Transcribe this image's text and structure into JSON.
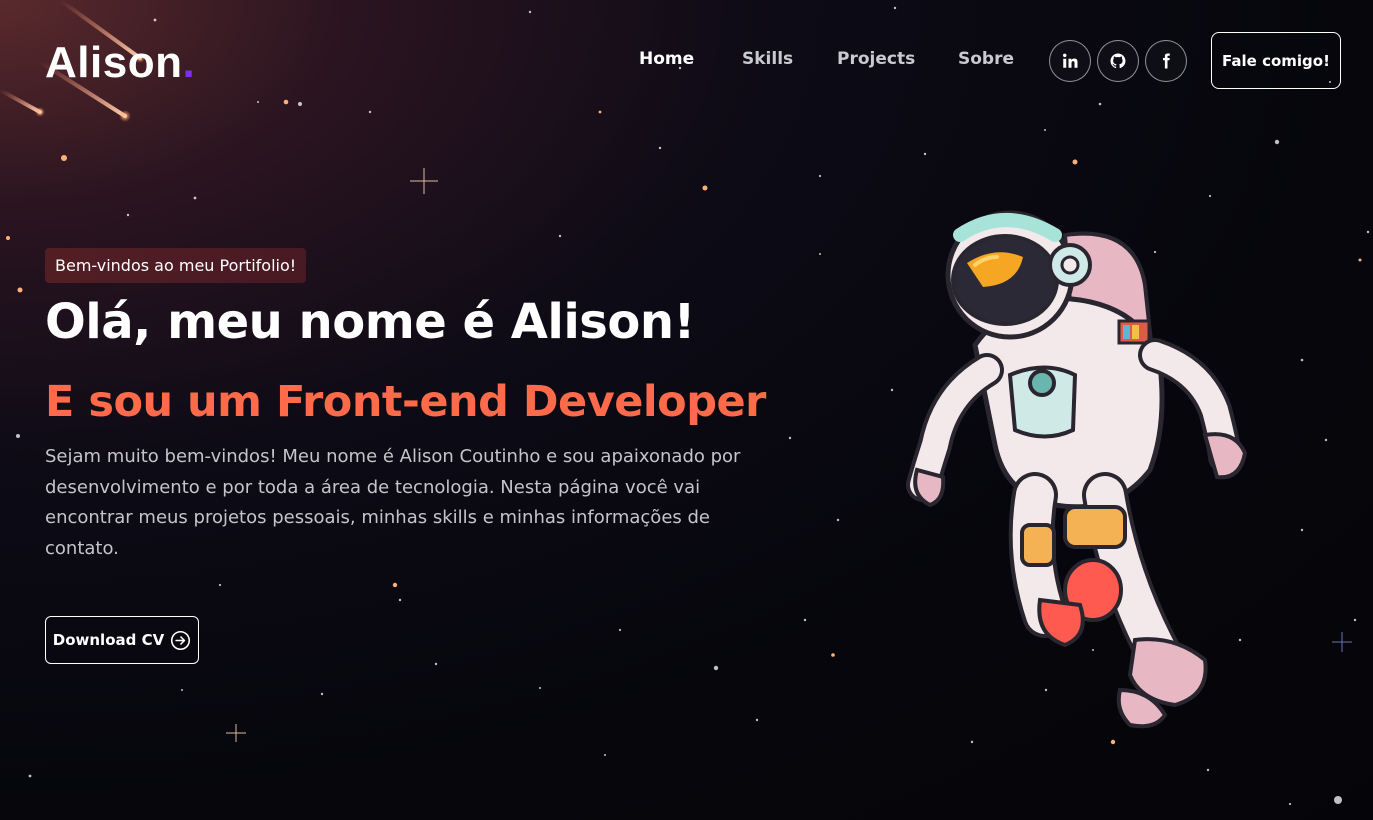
{
  "header": {
    "logo_text": "Alison",
    "logo_dot": ".",
    "nav": [
      {
        "label": "Home",
        "active": true
      },
      {
        "label": "Skills",
        "active": false
      },
      {
        "label": "Projects",
        "active": false
      },
      {
        "label": "Sobre",
        "active": false
      }
    ],
    "social": [
      {
        "icon": "linkedin-icon",
        "label": "in"
      },
      {
        "icon": "github-icon"
      },
      {
        "icon": "facebook-icon",
        "label": "f"
      }
    ],
    "cta_label": "Fale comigo!"
  },
  "hero": {
    "badge": "Bem-vindos ao meu Portifolio!",
    "title": "Olá, meu nome é Alison!",
    "subtitle": "E sou um Front-end Developer",
    "description": "Sejam muito bem-vindos! Meu nome é Alison Coutinho e sou apaixonado por desenvolvimento e por toda a área de tecnologia. Nesta página você vai encontrar meus projetos pessoais, minhas skills e minhas informações de contato.",
    "download_label": "Download CV",
    "download_icon": "arrow-right-circle-icon"
  },
  "illustration": {
    "name": "astronaut-illustration"
  },
  "colors": {
    "accent": "#ff6b4a",
    "logo_dot": "#7b2ff7",
    "background": "#06060c"
  }
}
